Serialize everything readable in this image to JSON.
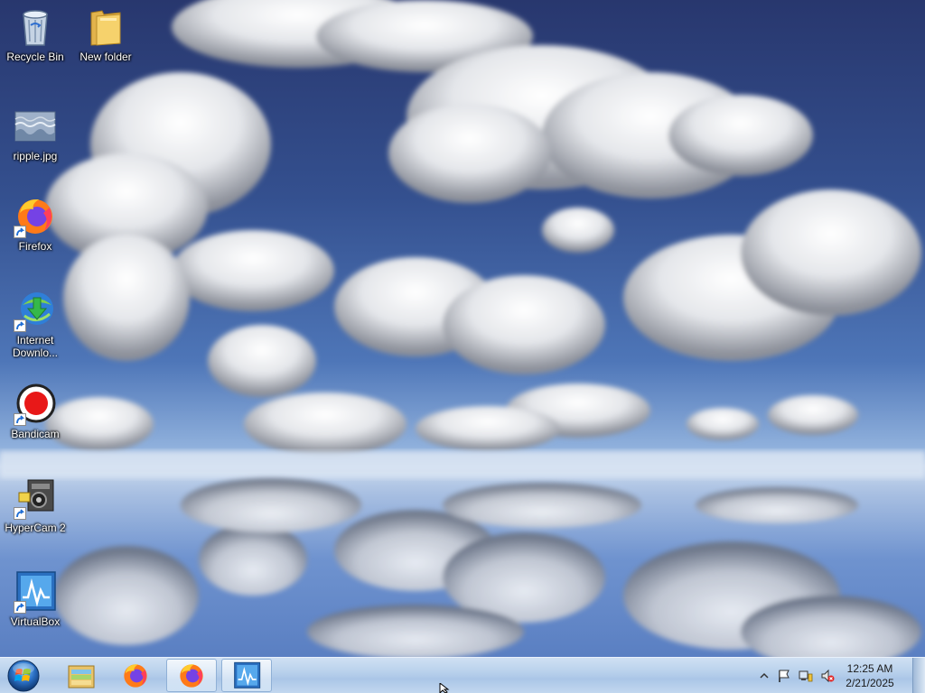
{
  "desktop": {
    "icons": [
      {
        "label": "Recycle Bin",
        "icon": "recycle-bin-icon"
      },
      {
        "label": "New folder",
        "icon": "folder-icon"
      },
      {
        "label": "ripple.jpg",
        "icon": "image-file-icon"
      },
      {
        "label": "Firefox",
        "icon": "firefox-icon"
      },
      {
        "label": "Internet Downlo...",
        "icon": "internet-download-manager-icon"
      },
      {
        "label": "Bandicam",
        "icon": "bandicam-icon"
      },
      {
        "label": "HyperCam 2",
        "icon": "hypercam-icon"
      },
      {
        "label": "VirtualBox",
        "icon": "virtualbox-icon"
      }
    ]
  },
  "taskbar": {
    "start": {
      "icon": "windows-start-orb-icon"
    },
    "pinned": [
      {
        "icon": "file-explorer-icon",
        "active": false
      },
      {
        "icon": "firefox-icon",
        "active": false
      },
      {
        "icon": "firefox-icon",
        "active": true
      },
      {
        "icon": "virtualbox-icon",
        "active": true
      }
    ],
    "tray": {
      "icons": [
        "show-hidden-icons-arrow",
        "action-center-flag-icon",
        "network-icon",
        "volume-muted-icon"
      ],
      "time": "12:25 AM",
      "date": "2/21/2025"
    }
  },
  "colors": {
    "sky_top": "#28376e",
    "sky_mid": "#4e76b8",
    "horizon": "#c9d9ee",
    "taskbar": "#b9d1ec"
  }
}
